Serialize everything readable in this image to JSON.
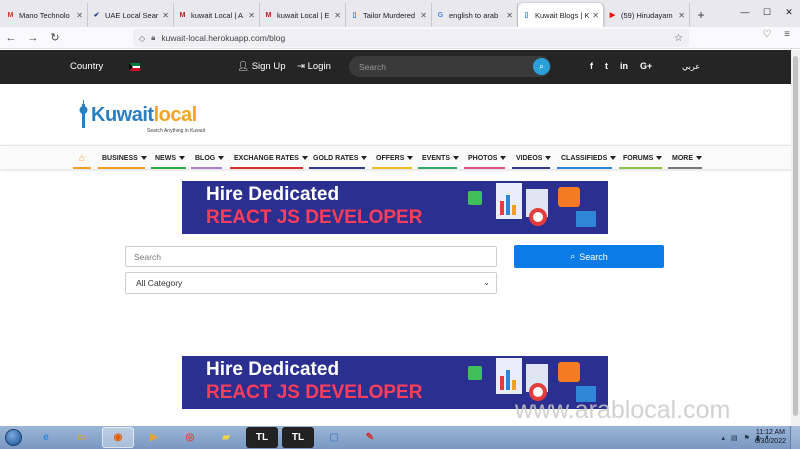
{
  "browser": {
    "tabs": [
      {
        "label": "Mano Technolo",
        "favicon": "gmail-icon",
        "color": "#d93025"
      },
      {
        "label": "UAE Local Sear",
        "favicon": "local-icon",
        "color": "#1e3a8a"
      },
      {
        "label": "kuwait Local | A",
        "favicon": "m-icon",
        "color": "#b91c1c"
      },
      {
        "label": "kuwait Local | E",
        "favicon": "m-icon",
        "color": "#b91c1c"
      },
      {
        "label": "Tailor Murdered",
        "favicon": "page-icon",
        "color": "#1e88e5"
      },
      {
        "label": "english to arab",
        "favicon": "google-icon",
        "color": "#4285f4"
      },
      {
        "label": "Kuwait Blogs | K",
        "favicon": "page-icon",
        "color": "#1e88e5"
      },
      {
        "label": "(59) Hirudayam",
        "favicon": "youtube-icon",
        "color": "#ff0000"
      }
    ],
    "url": "kuwait-local.herokuapp.com/blog"
  },
  "topbar": {
    "country_label": "Country",
    "signup_label": "Sign Up",
    "login_label": "Login",
    "search_placeholder": "Search",
    "language_label": "عربي",
    "social": [
      "f",
      "t",
      "in",
      "G+"
    ]
  },
  "logo": {
    "part1": "Kuwait",
    "part2": "local",
    "tagline": "Search Anything in Kuwait"
  },
  "menu": [
    {
      "label": "BUSINESS",
      "color": "#f0a020"
    },
    {
      "label": "NEWS",
      "color": "#2eaa4a"
    },
    {
      "label": "BLOG",
      "color": "#b07fd0"
    },
    {
      "label": "EXCHANGE RATES",
      "color": "#d9302e"
    },
    {
      "label": "GOLD RATES",
      "color": "#2f3b86"
    },
    {
      "label": "OFFERS",
      "color": "#f0c020"
    },
    {
      "label": "EVENTS",
      "color": "#2fa86a"
    },
    {
      "label": "PHOTOS",
      "color": "#e0527a"
    },
    {
      "label": "VIDEOS",
      "color": "#2f3b86"
    },
    {
      "label": "CLASSIFIEDS",
      "color": "#2f86d6"
    },
    {
      "label": "FORUMS",
      "color": "#8bc34a"
    },
    {
      "label": "MORE",
      "color": "#777777"
    }
  ],
  "ads": [
    {
      "line1": "Hire Dedicated",
      "line2": "REACT JS DEVELOPER"
    },
    {
      "line1": "Hire Dedicated",
      "line2": "REACT JS DEVELOPER"
    }
  ],
  "search_form": {
    "input_placeholder": "Search",
    "category_value": "All Category",
    "button_label": "Search"
  },
  "watermark": "www.arablocal.com",
  "taskbar": {
    "clock_time": "11:12 AM",
    "clock_date": "6/30/2022"
  },
  "colors": {
    "accent_blue": "#0b7be6",
    "topbar_bg": "#252525",
    "search_icon_bg": "#2aa0d8"
  }
}
